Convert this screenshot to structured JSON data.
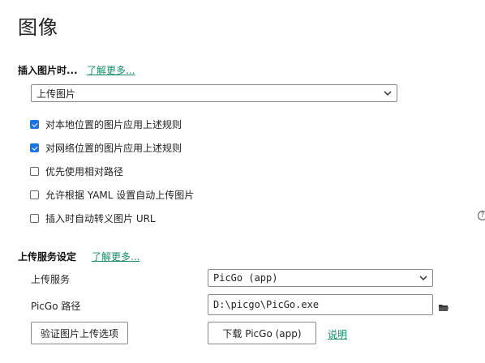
{
  "page": {
    "title": "图像"
  },
  "insert_section": {
    "title": "插入图片时...",
    "learn_more": "了解更多...",
    "action_select": {
      "selected": "上传图片"
    },
    "options": [
      {
        "label": "对本地位置的图片应用上述规则",
        "checked": true
      },
      {
        "label": "对网络位置的图片应用上述规则",
        "checked": true
      },
      {
        "label": "优先使用相对路径",
        "checked": false
      },
      {
        "label": "允许根据 YAML 设置自动上传图片",
        "checked": false
      },
      {
        "label": "插入时自动转义图片 URL",
        "checked": false
      }
    ],
    "help_glyph": "?"
  },
  "upload_section": {
    "title": "上传服务设定",
    "learn_more": "了解更多...",
    "service_label": "上传服务",
    "service_select": {
      "selected": "PicGo (app)"
    },
    "path_label": "PicGo 路径",
    "path_value": "D:\\picgo\\PicGo.exe",
    "verify_button": "验证图片上传选项",
    "download_button": "下载 PicGo (app)",
    "explain_link": "说明"
  },
  "icons": {
    "chevron": "chevron-down-icon",
    "folder": "folder-icon",
    "help": "help-icon"
  }
}
